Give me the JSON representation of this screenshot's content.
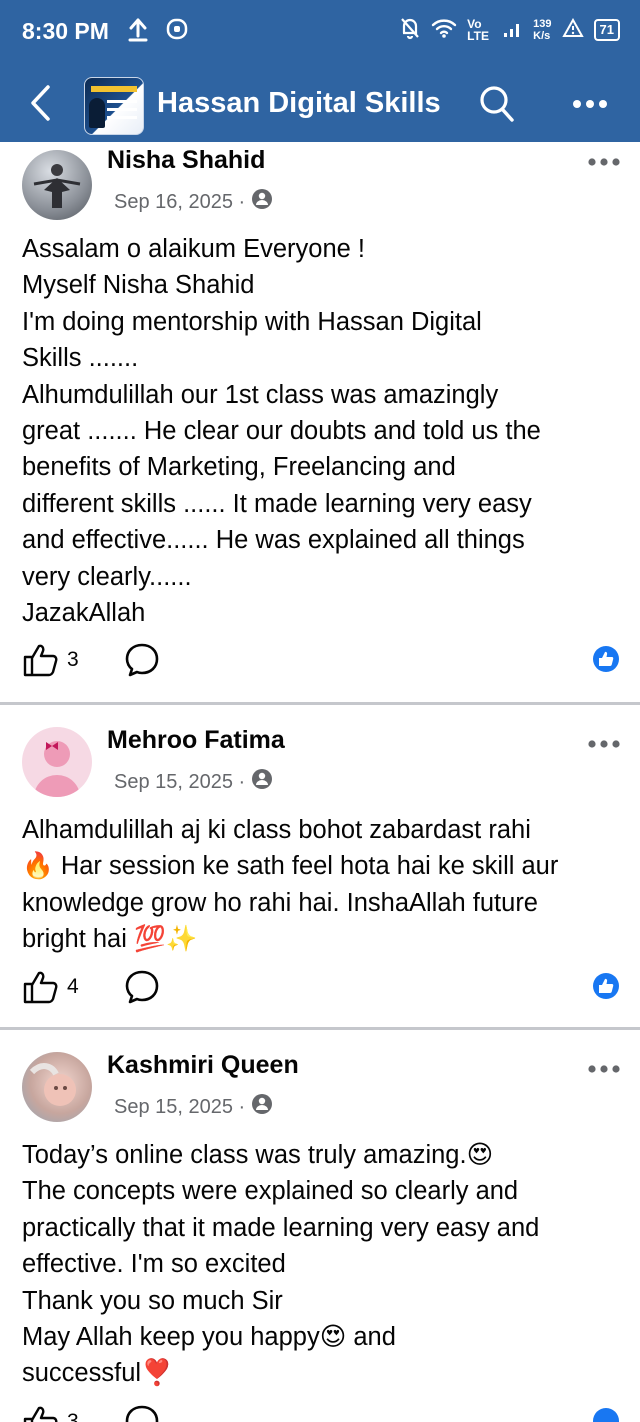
{
  "status_bar": {
    "time": "8:30 PM",
    "network_label": "Vo LTE",
    "speed_value": "139",
    "speed_unit": "K/s",
    "battery": "71"
  },
  "header": {
    "group_name": "Hassan Digital Skills",
    "avatar_text": "HASSAN DIGITAL"
  },
  "posts": [
    {
      "author": "Nisha Shahid",
      "date": "Sep 16, 2025 ·",
      "lines": [
        "Assalam o alaikum Everyone !",
        "Myself Nisha Shahid",
        "I'm doing mentorship with Hassan Digital",
        "Skills .......",
        "Alhumdulillah our 1st class was amazingly",
        "great ....... He clear our doubts and told us the",
        "benefits of Marketing, Freelancing and",
        "different skills ...... It made learning very easy",
        "and effective...... He was explained all things",
        "very clearly......",
        "JazakAllah"
      ],
      "like_count": "3"
    },
    {
      "author": "Mehroo Fatima",
      "date": "Sep 15, 2025 ·",
      "lines": [
        "Alhamdulillah aj ki class bohot zabardast rahi",
        "🔥 Har session ke sath feel hota hai ke skill aur",
        "knowledge grow ho rahi hai. InshaAllah future",
        "bright hai 💯✨"
      ],
      "like_count": "4"
    },
    {
      "author": "Kashmiri Queen",
      "date": "Sep 15, 2025 ·",
      "lines": [
        "Today’s online  class  was truly amazing.😍",
        "The concepts were explained so clearly and",
        "practically that it made learning very easy and",
        "effective. I'm so excited",
        "Thank you so much Sir",
        "May Allah keep you happy😍 and",
        "successful❣️"
      ],
      "like_count": "3"
    }
  ],
  "colors": {
    "header_bg": "#2f64a2",
    "reaction_blue": "#1877f2",
    "secondary_text": "#65676b"
  }
}
